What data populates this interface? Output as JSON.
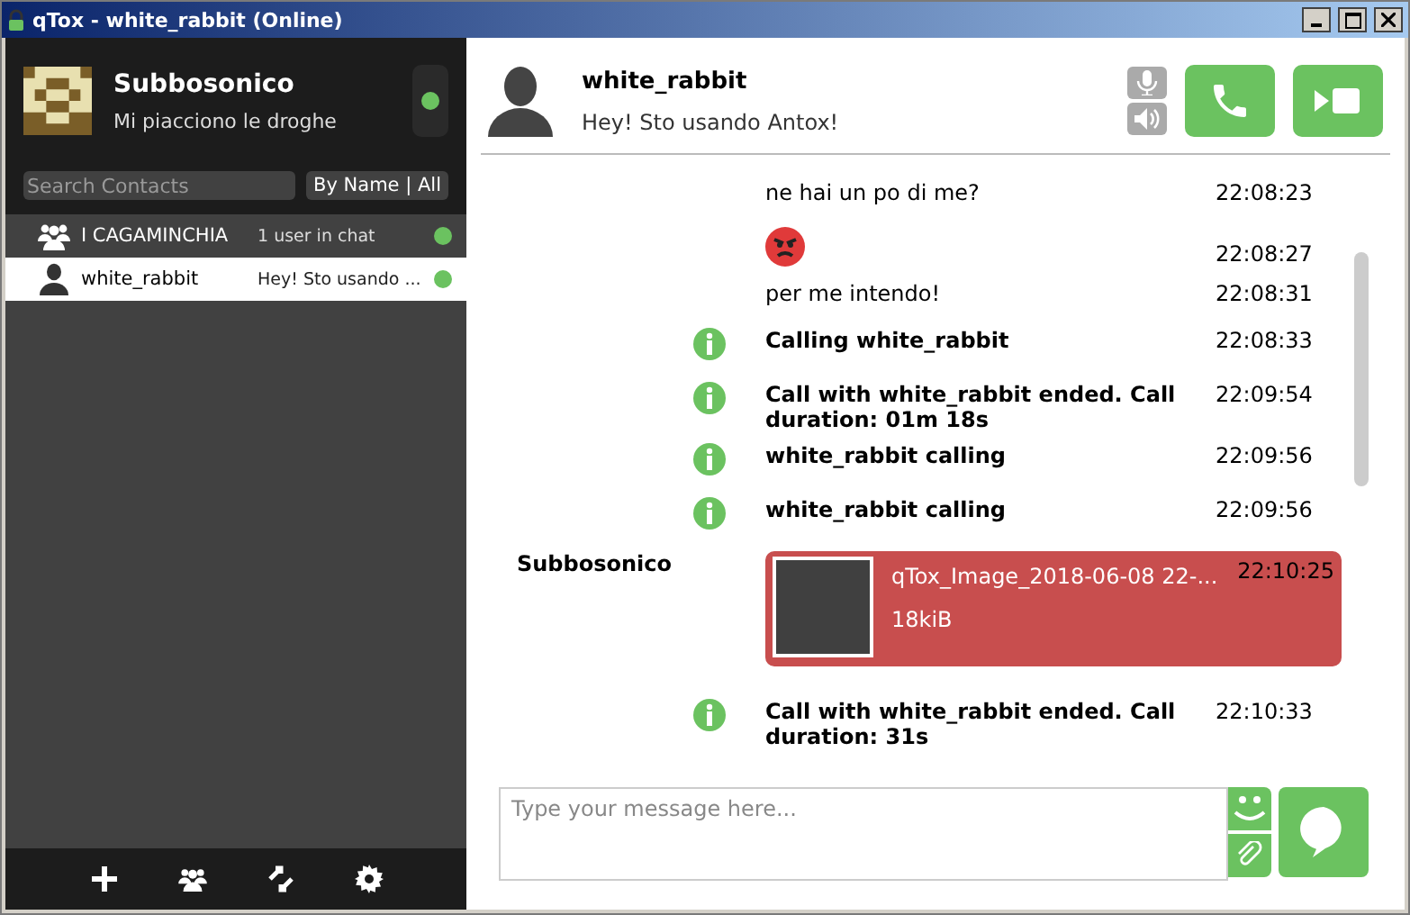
{
  "window": {
    "title": "qTox - white_rabbit (Online)"
  },
  "profile": {
    "name": "Subbosonico",
    "status_message": "Mi piacciono le droghe"
  },
  "search": {
    "placeholder": "Search Contacts"
  },
  "filter": {
    "label": "By Name | All"
  },
  "contacts": [
    {
      "kind": "group",
      "name": "I CAGAMINCHIA",
      "status": "1 user in chat",
      "selected": false,
      "color": "#6bc260"
    },
    {
      "kind": "friend",
      "name": "white_rabbit",
      "status": "Hey! Sto usando ...",
      "selected": true,
      "color": "#6bc260"
    }
  ],
  "chat_header": {
    "name": "white_rabbit",
    "status_message": "Hey! Sto usando Antox!"
  },
  "messages": [
    {
      "kind": "text",
      "text": "ne hai un po di me?",
      "time": "22:08:23"
    },
    {
      "kind": "emoji",
      "time": "22:08:27"
    },
    {
      "kind": "text",
      "text": "per me intendo!",
      "time": "22:08:31"
    },
    {
      "kind": "info",
      "text": "Calling white_rabbit",
      "time": "22:08:33"
    },
    {
      "kind": "info",
      "text": "Call with white_rabbit ended. Call duration: 01m 18s",
      "time": "22:09:54"
    },
    {
      "kind": "info",
      "text": "white_rabbit calling",
      "time": "22:09:56"
    },
    {
      "kind": "info",
      "text": "white_rabbit calling",
      "time": "22:09:56"
    },
    {
      "kind": "file",
      "author": "Subbosonico",
      "file_name": "qTox_Image_2018-06-08 22-...",
      "size": "18kiB",
      "time": "22:10:25"
    },
    {
      "kind": "info",
      "text": "Call with white_rabbit ended. Call duration: 31s",
      "time": "22:10:33"
    }
  ],
  "composer": {
    "placeholder": "Type your message here..."
  }
}
